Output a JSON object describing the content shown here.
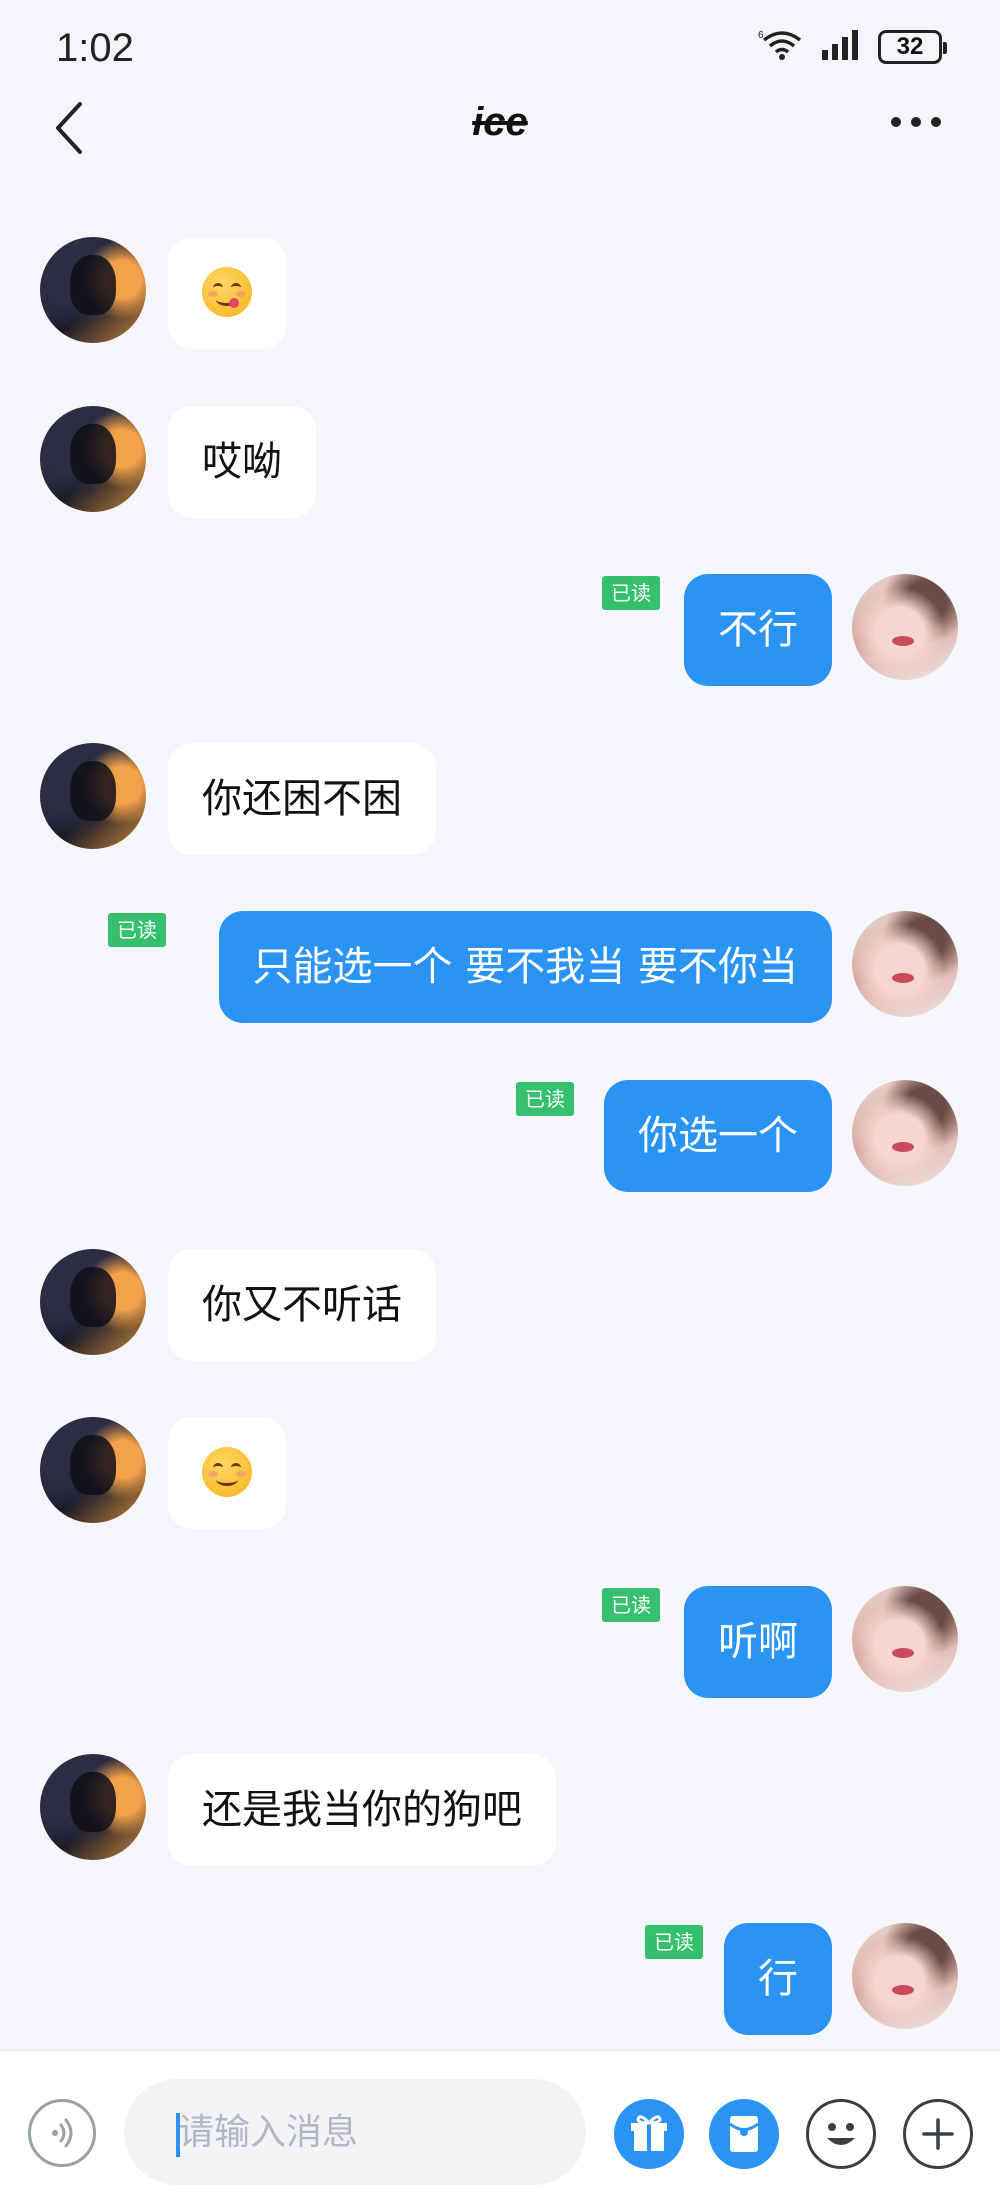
{
  "status_bar": {
    "time": "1:02",
    "battery": "32"
  },
  "header": {
    "title": "ice"
  },
  "messages": [
    {
      "side": "left",
      "type": "emoji",
      "emoji": "yum-face-emoji"
    },
    {
      "side": "left",
      "type": "text",
      "text": "哎呦"
    },
    {
      "side": "right",
      "type": "text",
      "text": "不行",
      "read": "已读"
    },
    {
      "side": "left",
      "type": "text",
      "text": "你还困不困"
    },
    {
      "side": "right",
      "type": "text",
      "text": "只能选一个 要不我当 要不你当",
      "read": "已读"
    },
    {
      "side": "right",
      "type": "text",
      "text": "你选一个",
      "read": "已读"
    },
    {
      "side": "left",
      "type": "text",
      "text": "你又不听话"
    },
    {
      "side": "left",
      "type": "emoji",
      "emoji": "smiling-face-emoji"
    },
    {
      "side": "right",
      "type": "text",
      "text": "听啊",
      "read": "已读"
    },
    {
      "side": "left",
      "type": "text",
      "text": "还是我当你的狗吧"
    },
    {
      "side": "right",
      "type": "text",
      "text": "行",
      "read": "已读"
    }
  ],
  "input": {
    "placeholder": "请输入消息"
  },
  "colors": {
    "accent": "#2a94f4",
    "read_badge": "#35c06e",
    "background": "#f4f6f9"
  }
}
